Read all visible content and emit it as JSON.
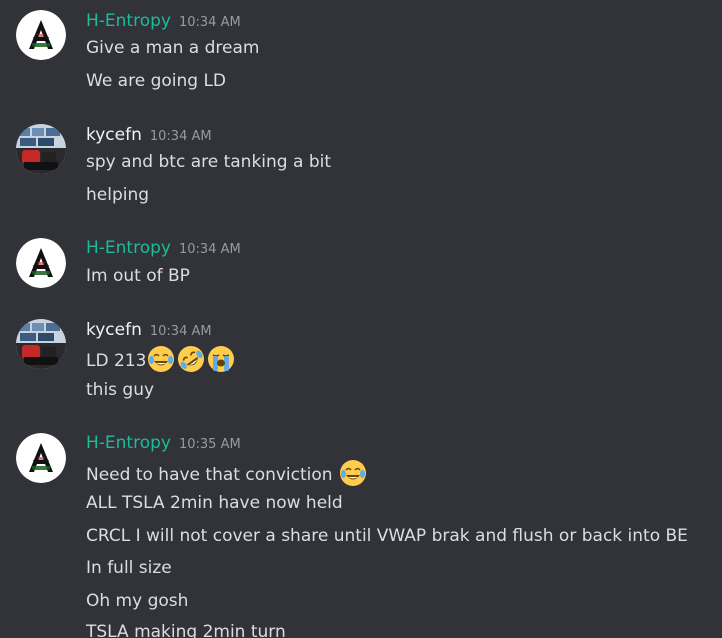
{
  "users": {
    "hentropy": {
      "name": "H-Entropy",
      "color": "#1abc9c"
    },
    "kycefn": {
      "name": "kycefn",
      "color": "#f2f3f5"
    }
  },
  "messages": [
    {
      "author": "H-Entropy",
      "timestamp": "10:34 AM",
      "lines": [
        "Give a man a dream",
        "We are going LD"
      ]
    },
    {
      "author": "kycefn",
      "timestamp": "10:34 AM",
      "lines": [
        "spy and btc are tanking a bit",
        "helping"
      ]
    },
    {
      "author": "H-Entropy",
      "timestamp": "10:34 AM",
      "lines": [
        "Im out of BP"
      ]
    },
    {
      "author": "kycefn",
      "timestamp": "10:34 AM",
      "lines": [
        "LD 213",
        "this guy"
      ],
      "emojis": [
        "joy",
        "rofl",
        "sob"
      ]
    },
    {
      "author": "H-Entropy",
      "timestamp": "10:35 AM",
      "lines": [
        "Need to have that conviction",
        "ALL TSLA 2min have now held",
        "CRCL I will not cover a share until VWAP brak and flush or back into BE",
        "In full size",
        "Oh my gosh",
        "TSLA making 2min turn"
      ],
      "emojis": [
        "joy"
      ]
    }
  ],
  "icons": {
    "hentropy_avatar": "entropy-logo-icon",
    "kycefn_avatar": "user-photo-avatar",
    "joy": "face-with-tears-of-joy-icon",
    "rofl": "rolling-on-floor-laughing-icon",
    "sob": "loudly-crying-face-icon"
  },
  "colors": {
    "background": "#313338",
    "text": "#dbdee1",
    "timestamp": "#949ba4"
  }
}
